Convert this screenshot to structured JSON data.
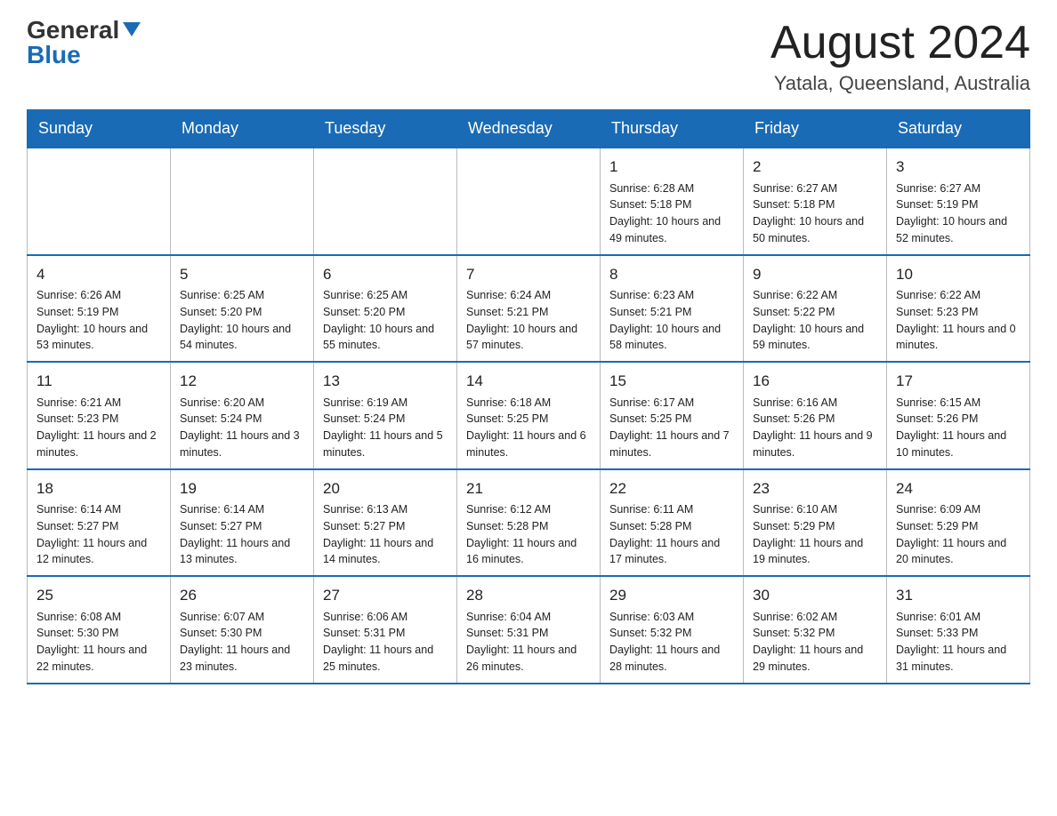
{
  "logo": {
    "general": "General",
    "blue": "Blue"
  },
  "header": {
    "month": "August 2024",
    "location": "Yatala, Queensland, Australia"
  },
  "days_of_week": [
    "Sunday",
    "Monday",
    "Tuesday",
    "Wednesday",
    "Thursday",
    "Friday",
    "Saturday"
  ],
  "weeks": [
    [
      {
        "day": "",
        "info": ""
      },
      {
        "day": "",
        "info": ""
      },
      {
        "day": "",
        "info": ""
      },
      {
        "day": "",
        "info": ""
      },
      {
        "day": "1",
        "info": "Sunrise: 6:28 AM\nSunset: 5:18 PM\nDaylight: 10 hours and 49 minutes."
      },
      {
        "day": "2",
        "info": "Sunrise: 6:27 AM\nSunset: 5:18 PM\nDaylight: 10 hours and 50 minutes."
      },
      {
        "day": "3",
        "info": "Sunrise: 6:27 AM\nSunset: 5:19 PM\nDaylight: 10 hours and 52 minutes."
      }
    ],
    [
      {
        "day": "4",
        "info": "Sunrise: 6:26 AM\nSunset: 5:19 PM\nDaylight: 10 hours and 53 minutes."
      },
      {
        "day": "5",
        "info": "Sunrise: 6:25 AM\nSunset: 5:20 PM\nDaylight: 10 hours and 54 minutes."
      },
      {
        "day": "6",
        "info": "Sunrise: 6:25 AM\nSunset: 5:20 PM\nDaylight: 10 hours and 55 minutes."
      },
      {
        "day": "7",
        "info": "Sunrise: 6:24 AM\nSunset: 5:21 PM\nDaylight: 10 hours and 57 minutes."
      },
      {
        "day": "8",
        "info": "Sunrise: 6:23 AM\nSunset: 5:21 PM\nDaylight: 10 hours and 58 minutes."
      },
      {
        "day": "9",
        "info": "Sunrise: 6:22 AM\nSunset: 5:22 PM\nDaylight: 10 hours and 59 minutes."
      },
      {
        "day": "10",
        "info": "Sunrise: 6:22 AM\nSunset: 5:23 PM\nDaylight: 11 hours and 0 minutes."
      }
    ],
    [
      {
        "day": "11",
        "info": "Sunrise: 6:21 AM\nSunset: 5:23 PM\nDaylight: 11 hours and 2 minutes."
      },
      {
        "day": "12",
        "info": "Sunrise: 6:20 AM\nSunset: 5:24 PM\nDaylight: 11 hours and 3 minutes."
      },
      {
        "day": "13",
        "info": "Sunrise: 6:19 AM\nSunset: 5:24 PM\nDaylight: 11 hours and 5 minutes."
      },
      {
        "day": "14",
        "info": "Sunrise: 6:18 AM\nSunset: 5:25 PM\nDaylight: 11 hours and 6 minutes."
      },
      {
        "day": "15",
        "info": "Sunrise: 6:17 AM\nSunset: 5:25 PM\nDaylight: 11 hours and 7 minutes."
      },
      {
        "day": "16",
        "info": "Sunrise: 6:16 AM\nSunset: 5:26 PM\nDaylight: 11 hours and 9 minutes."
      },
      {
        "day": "17",
        "info": "Sunrise: 6:15 AM\nSunset: 5:26 PM\nDaylight: 11 hours and 10 minutes."
      }
    ],
    [
      {
        "day": "18",
        "info": "Sunrise: 6:14 AM\nSunset: 5:27 PM\nDaylight: 11 hours and 12 minutes."
      },
      {
        "day": "19",
        "info": "Sunrise: 6:14 AM\nSunset: 5:27 PM\nDaylight: 11 hours and 13 minutes."
      },
      {
        "day": "20",
        "info": "Sunrise: 6:13 AM\nSunset: 5:27 PM\nDaylight: 11 hours and 14 minutes."
      },
      {
        "day": "21",
        "info": "Sunrise: 6:12 AM\nSunset: 5:28 PM\nDaylight: 11 hours and 16 minutes."
      },
      {
        "day": "22",
        "info": "Sunrise: 6:11 AM\nSunset: 5:28 PM\nDaylight: 11 hours and 17 minutes."
      },
      {
        "day": "23",
        "info": "Sunrise: 6:10 AM\nSunset: 5:29 PM\nDaylight: 11 hours and 19 minutes."
      },
      {
        "day": "24",
        "info": "Sunrise: 6:09 AM\nSunset: 5:29 PM\nDaylight: 11 hours and 20 minutes."
      }
    ],
    [
      {
        "day": "25",
        "info": "Sunrise: 6:08 AM\nSunset: 5:30 PM\nDaylight: 11 hours and 22 minutes."
      },
      {
        "day": "26",
        "info": "Sunrise: 6:07 AM\nSunset: 5:30 PM\nDaylight: 11 hours and 23 minutes."
      },
      {
        "day": "27",
        "info": "Sunrise: 6:06 AM\nSunset: 5:31 PM\nDaylight: 11 hours and 25 minutes."
      },
      {
        "day": "28",
        "info": "Sunrise: 6:04 AM\nSunset: 5:31 PM\nDaylight: 11 hours and 26 minutes."
      },
      {
        "day": "29",
        "info": "Sunrise: 6:03 AM\nSunset: 5:32 PM\nDaylight: 11 hours and 28 minutes."
      },
      {
        "day": "30",
        "info": "Sunrise: 6:02 AM\nSunset: 5:32 PM\nDaylight: 11 hours and 29 minutes."
      },
      {
        "day": "31",
        "info": "Sunrise: 6:01 AM\nSunset: 5:33 PM\nDaylight: 11 hours and 31 minutes."
      }
    ]
  ]
}
